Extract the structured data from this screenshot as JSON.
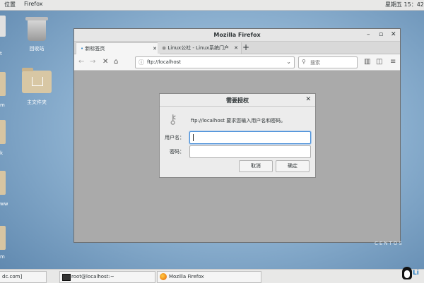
{
  "topbar": {
    "places": "位置",
    "app": "Firefox",
    "clock": "星期五 15：42"
  },
  "desktop": {
    "trash_label": "回收站",
    "home_label": "主文件夹",
    "left_edge_labels": [
      "t",
      "m",
      "k",
      "ww",
      "m"
    ]
  },
  "browser": {
    "window_title": "Mozilla Firefox",
    "tabs": [
      {
        "label": "新标签页"
      },
      {
        "label": "Linux公社 - Linux系统门户"
      }
    ],
    "url": "ftp://localhost",
    "search_placeholder": "搜索"
  },
  "auth_dialog": {
    "title": "需要授权",
    "message": "ftp://localhost 要求您输入用户名和密码。",
    "username_label": "用户名：",
    "username_value": "",
    "password_label": "密码：",
    "password_value": "",
    "cancel_label": "取消",
    "ok_label": "确定"
  },
  "taskbar": {
    "items": [
      {
        "label": "dc.com]"
      },
      {
        "label": "root@localhost:~"
      },
      {
        "label": "Mozilla Firefox"
      }
    ]
  },
  "branding": {
    "watermark": "CENTOS",
    "corner": "Li"
  },
  "icons": [
    "trash-icon",
    "folder-icon",
    "home-icon",
    "back-icon",
    "forward-icon",
    "stop-icon",
    "home-nav-icon",
    "search-icon",
    "library-icon",
    "sidebar-icon",
    "menu-icon",
    "key-icon",
    "terminal-icon",
    "firefox-icon",
    "tux-icon"
  ]
}
